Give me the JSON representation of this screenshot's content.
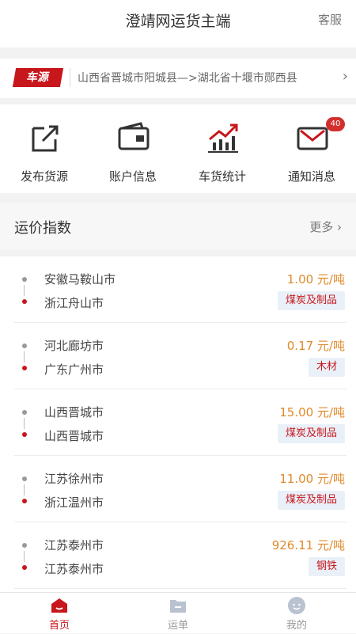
{
  "header": {
    "title": "澄靖网运货主端",
    "service": "客服"
  },
  "notice": {
    "tag": "车源",
    "route": "山西省晋城市阳城县—>湖北省十堰市郧西县",
    "chevron": "›",
    "icon": "chevron-right-icon"
  },
  "grid": [
    {
      "label": "发布货源",
      "icon": "publish-icon"
    },
    {
      "label": "账户信息",
      "icon": "wallet-icon"
    },
    {
      "label": "车货统计",
      "icon": "stats-chart-icon"
    },
    {
      "label": "通知消息",
      "icon": "mail-icon",
      "badge": "40"
    }
  ],
  "index": {
    "title": "运价指数",
    "more": "更多",
    "more_chevron": "›"
  },
  "rows": [
    {
      "from": "安徽马鞍山市",
      "to": "浙江舟山市",
      "price": "1.00 元/吨",
      "cargo": "煤炭及制品"
    },
    {
      "from": "河北廊坊市",
      "to": "广东广州市",
      "price": "0.17 元/吨",
      "cargo": "木材"
    },
    {
      "from": "山西晋城市",
      "to": "山西晋城市",
      "price": "15.00 元/吨",
      "cargo": "煤炭及制品"
    },
    {
      "from": "江苏徐州市",
      "to": "浙江温州市",
      "price": "11.00 元/吨",
      "cargo": "煤炭及制品"
    },
    {
      "from": "江苏泰州市",
      "to": "江苏泰州市",
      "price": "926.11 元/吨",
      "cargo": "钢铁"
    }
  ],
  "tabs": [
    {
      "label": "首页",
      "icon": "home-icon",
      "active": true
    },
    {
      "label": "运单",
      "icon": "folder-icon",
      "active": false
    },
    {
      "label": "我的",
      "icon": "profile-icon",
      "active": false
    }
  ],
  "colors": {
    "accent": "#c8161d",
    "price": "#e08a2a",
    "tag_bg": "#eaf0f8",
    "icon": "#333333"
  }
}
